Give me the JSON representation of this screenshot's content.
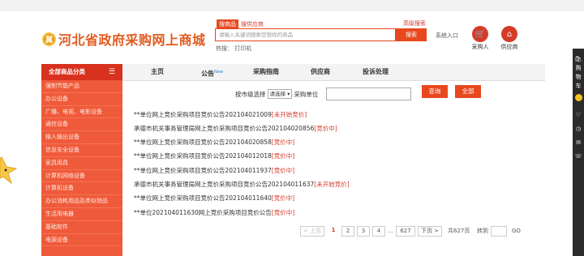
{
  "header": {
    "logo_text": "河北省政府采购网上商城",
    "logo_badge": "冀",
    "search_tabs": [
      "搜商品",
      "搜供应商"
    ],
    "advanced_search": "高级搜索",
    "search_placeholder": "请输入关键词搜索您想找的商品",
    "search_button": "搜索",
    "hot_label": "热搜：",
    "hot_item": "打印机",
    "login": "系统入口",
    "buyer_label": "采购人",
    "supplier_label": "供应商"
  },
  "nav": {
    "category_header": "全部商品分类",
    "items": [
      "主页",
      "公告",
      "采购指南",
      "供应商",
      "投诉处理"
    ],
    "new_badge": "New"
  },
  "categories": [
    "强制节能产品",
    "办公设备",
    "广播、电视、电影设备",
    "通信设备",
    "输入输出设备",
    "信息安全设备",
    "家具用具",
    "计算机网络设备",
    "计算机设备",
    "办公消耗用品及类似物品",
    "生活用电器",
    "基础软件",
    "电源设备"
  ],
  "filter": {
    "label_before": "按市级选择",
    "select_value": "请选择",
    "label_after": "采购单位",
    "query_button": "查询",
    "all_button": "全部"
  },
  "notices": [
    {
      "title": "**单位网上竞价采购项目竞价公告202104021009",
      "status": "[未开始竞价]"
    },
    {
      "title": "承德市机关事务管理局网上竞价采购项目竞价公告202104020856",
      "status": "[竞价中]"
    },
    {
      "title": "**单位网上竞价采购项目竞价公告202104020858",
      "status": "[竞价中]"
    },
    {
      "title": "**单位网上竞价采购项目竞价公告202104012018",
      "status": "[竞价中]"
    },
    {
      "title": "**单位网上竞价采购项目竞价公告202104011937",
      "status": "[竞价中]"
    },
    {
      "title": "承德市机关事务管理局网上竞价采购项目竞价公告202104011637",
      "status": "[未开始竞价]"
    },
    {
      "title": "**单位网上竞价采购项目竞价公告202104011640",
      "status": "[竞价中]"
    },
    {
      "title": "**单位202104011630网上竞价采购项目竞价公告",
      "status": "[竞价中]"
    }
  ],
  "pagination": {
    "prev": "< 上页",
    "pages": [
      "1",
      "2",
      "3",
      "4"
    ],
    "ellipsis": "...",
    "last": "627",
    "next": "下页 >",
    "total": "共627页",
    "goto": "转到",
    "go": "GO"
  },
  "right_sidebar": [
    "购",
    "物",
    "车"
  ]
}
